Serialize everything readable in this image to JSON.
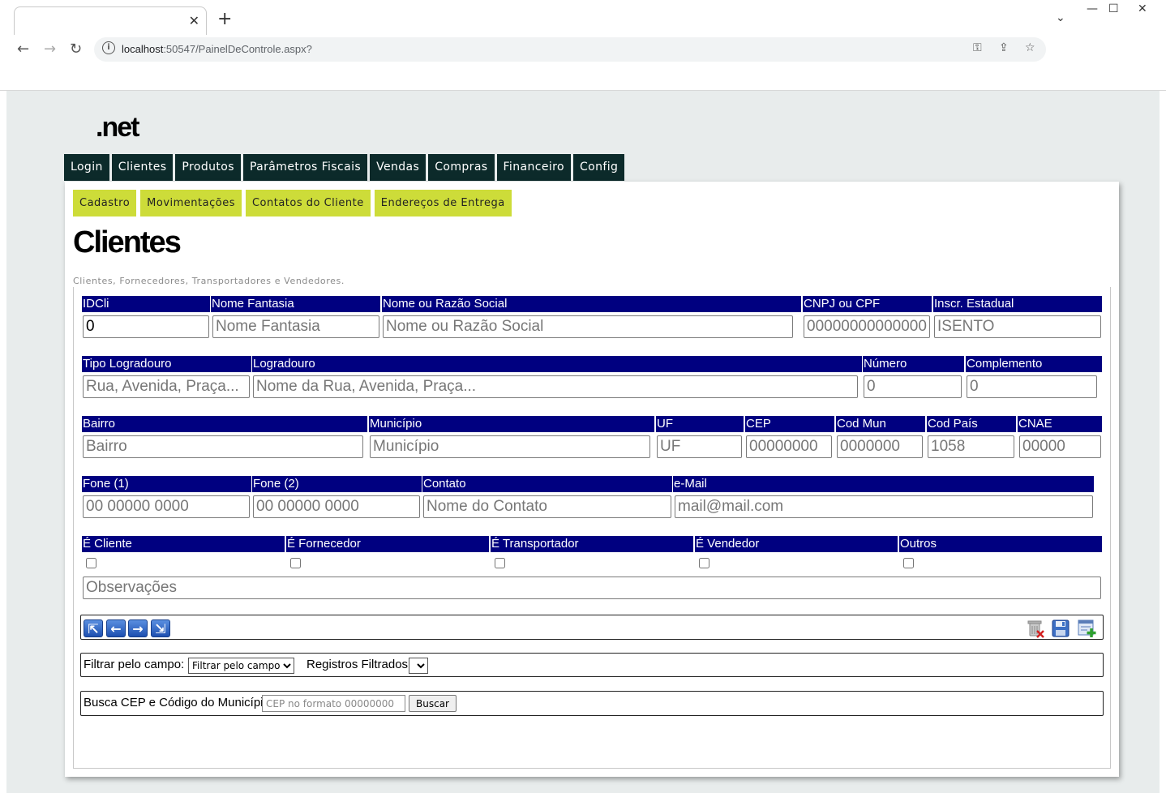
{
  "browser": {
    "tab_title": "",
    "tab_close": "✕",
    "new_tab": "+",
    "win_dropdown": "⌄",
    "win_minimize": "—",
    "win_maximize": "☐",
    "win_close": "✕",
    "back": "←",
    "forward": "→",
    "reload": "↻",
    "url_host": "localhost",
    "url_path": ":50547/PainelDeControle.aspx?",
    "info_icon": "i",
    "key_icon": "⚿",
    "share_icon": "⇪",
    "star_icon": "☆"
  },
  "site": {
    "logo": ".net",
    "main_menu": [
      "Login",
      "Clientes",
      "Produtos",
      "Parâmetros Fiscais",
      "Vendas",
      "Compras",
      "Financeiro",
      "Config"
    ],
    "sub_menu": [
      "Cadastro",
      "Movimentações",
      "Contatos do Cliente",
      "Endereços de Entrega"
    ],
    "page_title": "Clientes",
    "page_subtitle": "Clientes, Fornecedores, Transportadores e Vendedores."
  },
  "form": {
    "row1": {
      "idcli": {
        "label": "IDCli",
        "value": "0",
        "placeholder": ""
      },
      "nome_fantasia": {
        "label": "Nome Fantasia",
        "value": "",
        "placeholder": "Nome Fantasia"
      },
      "razao_social": {
        "label": "Nome ou Razão Social",
        "value": "",
        "placeholder": "Nome ou Razão Social"
      },
      "cnpj_cpf": {
        "label": "CNPJ ou CPF",
        "value": "",
        "placeholder": "00000000000000"
      },
      "inscr_estadual": {
        "label": "Inscr. Estadual",
        "value": "",
        "placeholder": "ISENTO"
      }
    },
    "row2": {
      "tipo_logradouro": {
        "label": "Tipo Logradouro",
        "value": "",
        "placeholder": "Rua, Avenida, Praça..."
      },
      "logradouro": {
        "label": "Logradouro",
        "value": "",
        "placeholder": "Nome da Rua, Avenida, Praça..."
      },
      "numero": {
        "label": "Número",
        "value": "",
        "placeholder": "0"
      },
      "complemento": {
        "label": "Complemento",
        "value": "",
        "placeholder": "0"
      }
    },
    "row3": {
      "bairro": {
        "label": "Bairro",
        "value": "",
        "placeholder": "Bairro"
      },
      "municipio": {
        "label": "Município",
        "value": "",
        "placeholder": "Município"
      },
      "uf": {
        "label": "UF",
        "value": "",
        "placeholder": "UF"
      },
      "cep": {
        "label": "CEP",
        "value": "",
        "placeholder": "00000000"
      },
      "cod_mun": {
        "label": "Cod Mun",
        "value": "",
        "placeholder": "0000000"
      },
      "cod_pais": {
        "label": "Cod País",
        "value": "",
        "placeholder": "1058"
      },
      "cnae": {
        "label": "CNAE",
        "value": "",
        "placeholder": "00000"
      }
    },
    "row4": {
      "fone1": {
        "label": "Fone (1)",
        "value": "",
        "placeholder": "00 00000 0000"
      },
      "fone2": {
        "label": "Fone (2)",
        "value": "",
        "placeholder": "00 00000 0000"
      },
      "contato": {
        "label": "Contato",
        "value": "",
        "placeholder": "Nome do Contato"
      },
      "email": {
        "label": "e-Mail",
        "value": "",
        "placeholder": "mail@mail.com"
      }
    },
    "row5": {
      "e_cliente": {
        "label": "É Cliente",
        "checked": false
      },
      "e_fornecedor": {
        "label": "É Fornecedor",
        "checked": false
      },
      "e_transportador": {
        "label": "É Transportador",
        "checked": false
      },
      "e_vendedor": {
        "label": "É Vendedor",
        "checked": false
      },
      "outros": {
        "label": "Outros",
        "checked": false
      }
    },
    "observacoes": {
      "value": "",
      "placeholder": "Observações"
    }
  },
  "navigation": {
    "first_icon": "⇱",
    "prev_icon": "←",
    "next_icon": "→",
    "last_icon": "⇲"
  },
  "filter": {
    "label": "Filtrar pelo campo:",
    "selected": "Filtrar pelo campo",
    "registros_label": "Registros Filtrados:",
    "registros_selected": ""
  },
  "cep_search": {
    "label": "Busca CEP e Código do Município:",
    "placeholder": "CEP no formato 00000000",
    "button": "Buscar"
  },
  "colors": {
    "label_bg": "#000080",
    "menu_bg": "#0c2a2a",
    "submenu_bg": "#cddc39",
    "page_bg": "#e8ecec"
  }
}
